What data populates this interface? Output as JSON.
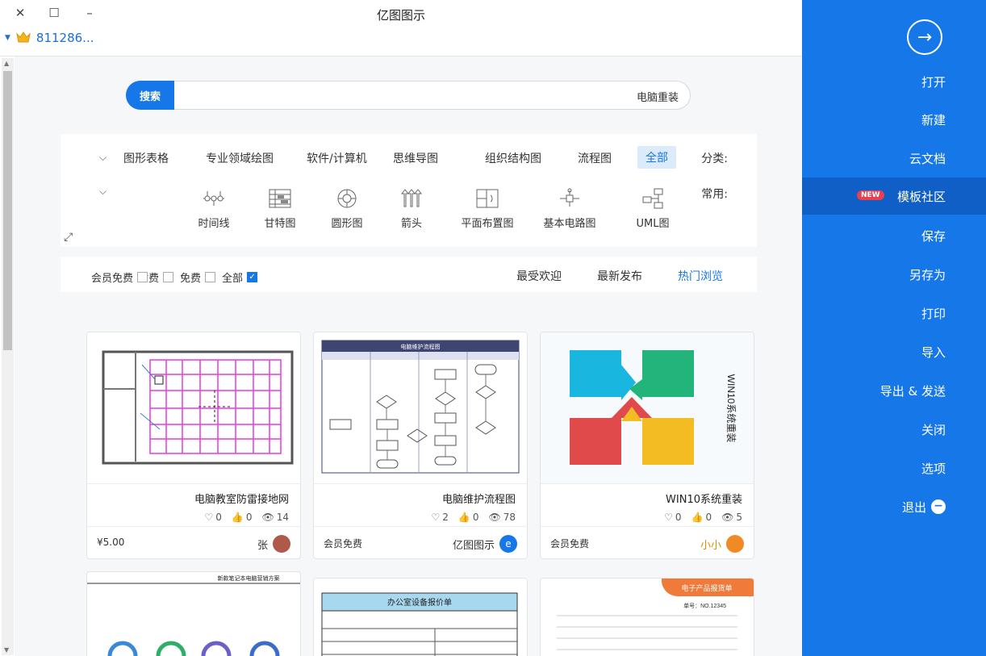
{
  "app": {
    "title": "亿图图示"
  },
  "user": {
    "name": "811286..."
  },
  "search": {
    "button": "搜索",
    "value": "电脑重装"
  },
  "categories": {
    "label": "分类:",
    "items": [
      "全部",
      "流程图",
      "组织结构图",
      "思维导图",
      "软件/计算机",
      "专业领域绘图",
      "图形表格"
    ],
    "active": "全部"
  },
  "common": {
    "label": "常用:",
    "items": [
      {
        "label": "UML图",
        "icon": "uml-icon"
      },
      {
        "label": "基本电路图",
        "icon": "circuit-icon"
      },
      {
        "label": "平面布置图",
        "icon": "floorplan-icon"
      },
      {
        "label": "箭头",
        "icon": "arrow-icon"
      },
      {
        "label": "圆形图",
        "icon": "circle-diagram-icon"
      },
      {
        "label": "甘特图",
        "icon": "gantt-icon"
      },
      {
        "label": "时间线",
        "icon": "timeline-icon"
      }
    ]
  },
  "filters": {
    "tabs": [
      "热门浏览",
      "最新发布",
      "最受欢迎"
    ],
    "active_tab": "热门浏览",
    "checks": [
      {
        "label": "全部",
        "checked": true
      },
      {
        "label": "免费",
        "checked": false
      },
      {
        "label": "付费",
        "checked": false
      },
      {
        "label": "会员免费",
        "checked": false
      }
    ]
  },
  "cards": [
    {
      "title": "WIN10系统重装",
      "views": "5",
      "likes": "0",
      "comments": "0",
      "author": "小小",
      "price": "会员免费"
    },
    {
      "title": "电脑维护流程图",
      "views": "78",
      "likes": "0",
      "comments": "2",
      "author": "亿图图示",
      "price": "会员免费"
    },
    {
      "title": "电脑教室防雷接地网",
      "views": "14",
      "likes": "0",
      "comments": "0",
      "author": "张",
      "price": "¥5.00"
    }
  ],
  "thumb_text": {
    "win10": "WIN10系统重装",
    "flow_header": "电脑维护流程图",
    "quote_title": "办公室设备报价单",
    "product_title": "电子产品报货单",
    "product_no": "单号：NO.12345",
    "notebook_title": "新款笔记本电脑营销方案"
  },
  "sidebar": {
    "items": [
      "打开",
      "新建",
      "云文档",
      "模板社区",
      "保存",
      "另存为",
      "打印",
      "导入",
      "导出 & 发送",
      "关闭",
      "选项",
      "退出"
    ],
    "active": "模板社区",
    "badge": "NEW"
  },
  "colors": {
    "accent": "#1677e8",
    "sidebar": "#1677e8",
    "badge": "#e9404f"
  }
}
